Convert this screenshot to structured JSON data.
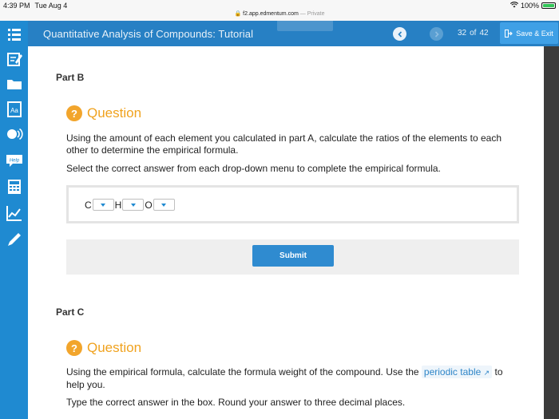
{
  "status_bar": {
    "time": "4:39 PM",
    "day": "Tue Aug 4",
    "battery": "100%",
    "battery_level": 1.0,
    "url": "f2.app.edmentum.com",
    "private": "— Private"
  },
  "header": {
    "title": "Quantitative Analysis of Compounds: Tutorial",
    "page_current": "32",
    "page_of": "of",
    "page_total": "42",
    "save_label": "Save & Exit"
  },
  "rail": {
    "icons": [
      "menu-icon",
      "notepad-icon",
      "folder-icon",
      "dictionary-icon",
      "audio-icon",
      "help-icon",
      "calculator-icon",
      "graph-icon",
      "pen-icon"
    ],
    "help_label": "Help"
  },
  "part_b": {
    "label": "Part B",
    "question_title": "Question",
    "text1": "Using the amount of each element you calculated in part A, calculate the ratios of the elements to each other to determine the empirical formula.",
    "text2": "Select the correct answer from each drop-down menu to complete the empirical formula.",
    "formula": {
      "c": "C",
      "h": "H",
      "o": "O"
    },
    "submit_label": "Submit"
  },
  "part_c": {
    "label": "Part C",
    "question_title": "Question",
    "text1_before": "Using the empirical formula, calculate the formula weight of the compound. Use the",
    "link": "periodic table",
    "text1_after": "to help you.",
    "text2": "Type the correct answer in the box. Round your answer to three decimal places."
  },
  "colors": {
    "rail": "#1f8ad1",
    "header": "#2780c4",
    "accent_orange": "#f0a21e",
    "button_blue": "#2f8bd0"
  }
}
